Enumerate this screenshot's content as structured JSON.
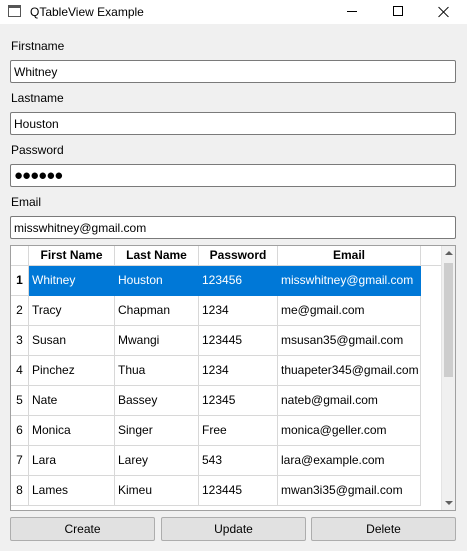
{
  "window": {
    "title": "QTableView Example",
    "icon": "window-app-icon",
    "controls": [
      "minimize-icon",
      "maximize-icon",
      "close-icon"
    ]
  },
  "form": {
    "firstname": {
      "label": "Firstname",
      "value": "Whitney"
    },
    "lastname": {
      "label": "Lastname",
      "value": "Houston"
    },
    "password": {
      "label": "Password",
      "value": "●●●●●●"
    },
    "email": {
      "label": "Email",
      "value": "misswhitney@gmail.com"
    }
  },
  "table": {
    "columns": [
      "First Name",
      "Last Name",
      "Password",
      "Email"
    ],
    "row_numbers": [
      "1",
      "2",
      "3",
      "4",
      "5",
      "6",
      "7",
      "8"
    ],
    "selected_row": 0,
    "rows": [
      [
        "Whitney",
        "Houston",
        "123456",
        "misswhitney@gmail.com"
      ],
      [
        "Tracy",
        "Chapman",
        "1234",
        "me@gmail.com"
      ],
      [
        "Susan",
        "Mwangi",
        "123445",
        "msusan35@gmail.com"
      ],
      [
        "Pinchez",
        "Thua",
        "1234",
        "thuapeter345@gmail.com"
      ],
      [
        "Nate",
        "Bassey",
        "12345",
        "nateb@gmail.com"
      ],
      [
        "Monica",
        "Singer",
        "Free",
        "monica@geller.com"
      ],
      [
        "Lara",
        "Larey",
        "543",
        "lara@example.com"
      ],
      [
        "Lames",
        "Kimeu",
        "123445",
        "mwan3i35@gmail.com"
      ]
    ]
  },
  "buttons": {
    "create": "Create",
    "update": "Update",
    "delete": "Delete"
  },
  "colors": {
    "selection": "#0078d7",
    "window_bg": "#f0f0f0"
  }
}
